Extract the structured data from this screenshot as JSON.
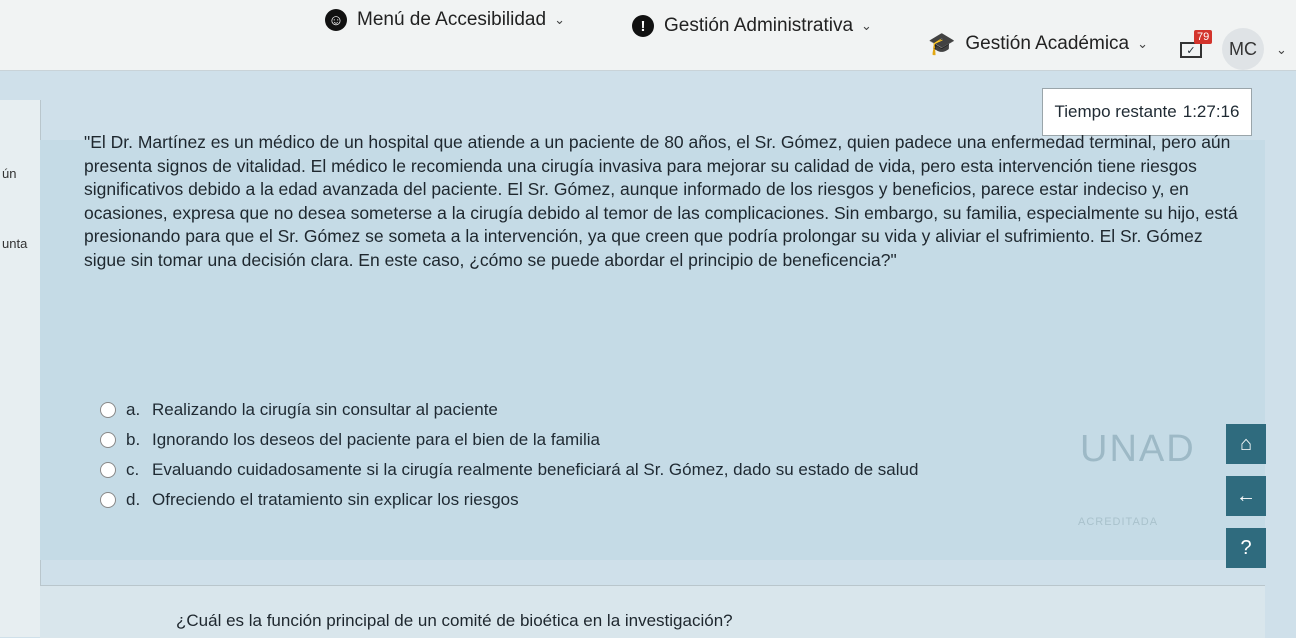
{
  "nav": {
    "accessibility": {
      "label": "Menú de Accesibilidad"
    },
    "admin": {
      "label": "Gestión Administrativa"
    },
    "academic": {
      "label": "Gestión Académica"
    },
    "messages_count": "79",
    "user_initials": "MC"
  },
  "timer": {
    "label": "Tiempo restante",
    "value": "1:27:16"
  },
  "left_fragments": [
    "ún",
    "unta"
  ],
  "question": {
    "text": "\"El Dr. Martínez es un médico de un hospital que atiende a un paciente de 80 años, el Sr. Gómez, quien padece una enfermedad terminal, pero aún presenta signos de vitalidad. El médico le recomienda una cirugía invasiva para mejorar su calidad de vida, pero esta intervención tiene riesgos significativos debido a la edad avanzada del paciente. El Sr. Gómez, aunque informado de los riesgos y beneficios, parece estar indeciso y, en ocasiones, expresa que no desea someterse a la cirugía debido al temor de las complicaciones. Sin embargo, su familia, especialmente su hijo, está presionando para que el Sr. Gómez se someta a la intervención, ya que creen que podría prolongar su vida y aliviar el sufrimiento. El Sr. Gómez sigue sin tomar una decisión clara. En este caso, ¿cómo se puede abordar el principio de beneficencia?\""
  },
  "answers": [
    {
      "letter": "a.",
      "text": "Realizando la cirugía sin consultar al paciente"
    },
    {
      "letter": "b.",
      "text": "Ignorando los deseos del paciente para el bien de la familia"
    },
    {
      "letter": "c.",
      "text": "Evaluando cuidadosamente si la cirugía realmente beneficiará al Sr. Gómez, dado su estado de salud"
    },
    {
      "letter": "d.",
      "text": "Ofreciendo el tratamiento sin explicar los riesgos"
    }
  ],
  "side_icons": [
    "home-icon",
    "back-arrow-icon",
    "help-icon"
  ],
  "watermark": {
    "logo": "UNAD",
    "sub": "ACREDITADA"
  },
  "next_question": {
    "text": "¿Cuál es la función principal de un comité de bioética en la investigación?"
  }
}
